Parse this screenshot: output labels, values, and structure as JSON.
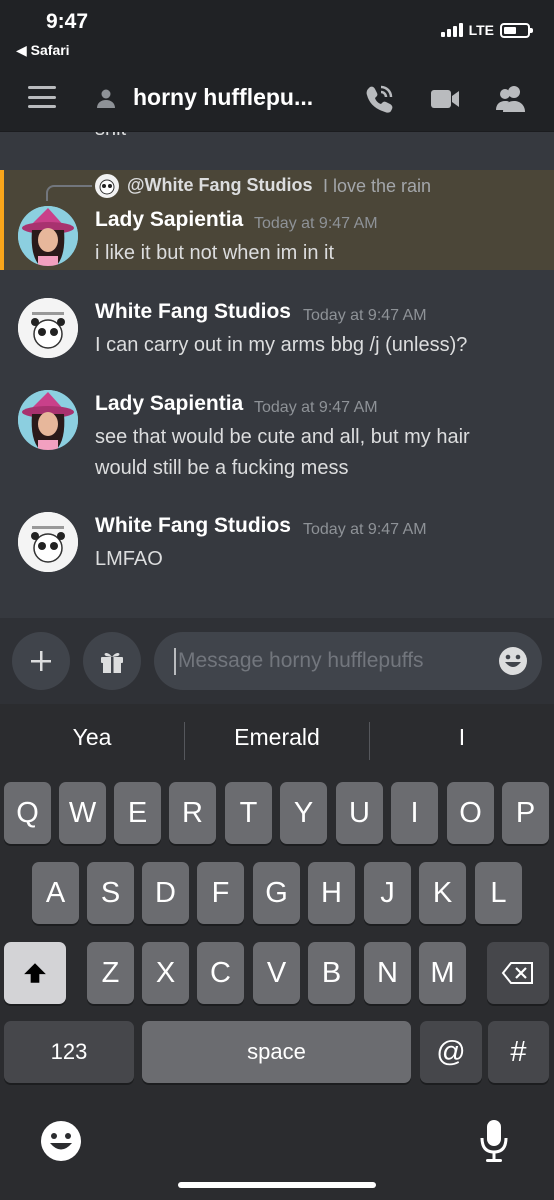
{
  "status_bar": {
    "time": "9:47",
    "back_app": "◀ Safari",
    "network": "LTE"
  },
  "header": {
    "channel_title": "horny hufflepu..."
  },
  "chat": {
    "cut_off_text": "shit",
    "reply": {
      "name": "@White Fang Studios",
      "text": "I love the rain"
    },
    "messages": [
      {
        "author": "Lady Sapientia",
        "timestamp": "Today at 9:47 AM",
        "lines": [
          "i like it but not when im in it"
        ]
      },
      {
        "author": "White Fang Studios",
        "timestamp": "Today at 9:47 AM",
        "lines": [
          "I can carry out in my arms bbg /j (unless)?"
        ]
      },
      {
        "author": "Lady Sapientia",
        "timestamp": "Today at 9:47 AM",
        "lines": [
          "see that would be cute and all, but my hair",
          "would still be a fucking mess"
        ]
      },
      {
        "author": "White Fang Studios",
        "timestamp": "Today at 9:47 AM",
        "lines": [
          "LMFAO"
        ]
      }
    ]
  },
  "input": {
    "placeholder": "Message horny hufflepuffs"
  },
  "keyboard": {
    "suggestions": [
      "Yea",
      "Emerald",
      "I"
    ],
    "row1": [
      "Q",
      "W",
      "E",
      "R",
      "T",
      "Y",
      "U",
      "I",
      "O",
      "P"
    ],
    "row2": [
      "A",
      "S",
      "D",
      "F",
      "G",
      "H",
      "J",
      "K",
      "L"
    ],
    "row3": [
      "Z",
      "X",
      "C",
      "V",
      "B",
      "N",
      "M"
    ],
    "numbers_key": "123",
    "space_key": "space",
    "at_key": "@",
    "hash_key": "#"
  },
  "colors": {
    "accent_mention": "#faa61a",
    "mention_bg": "#4b4638",
    "chat_bg": "#36393f",
    "header_bg": "#202225"
  }
}
